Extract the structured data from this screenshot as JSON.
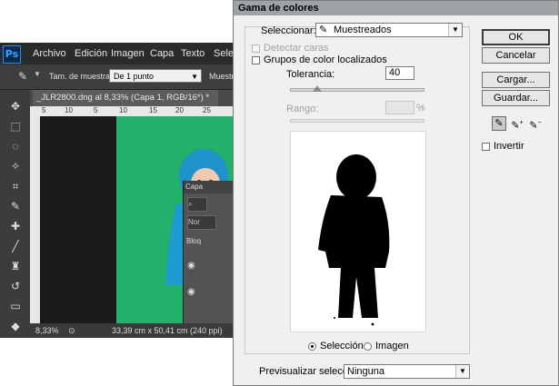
{
  "photoshop": {
    "logo": "Ps",
    "menus": [
      "Archivo",
      "Edición",
      "Imagen",
      "Capa",
      "Texto",
      "Selecc"
    ],
    "options": {
      "sample_size_label": "Tam. de muestra:",
      "sample_size_value": "De 1 punto",
      "sample_label": "Muestra:"
    },
    "document_tab": "_JLR2800.dng al 8,33% (Capa 1, RGB/16*) *",
    "ruler_ticks": [
      "5",
      "10",
      "5",
      "10",
      "15",
      "20",
      "25"
    ],
    "status": {
      "zoom": "8,33%",
      "doc_info": "33,39 cm x 50,41 cm (240 ppi)"
    },
    "layers_panel": {
      "title": "Capa",
      "kind_text": "Nor",
      "lock_text": "Bloq"
    }
  },
  "dialog": {
    "title": "Gama de colores",
    "select_label": "Seleccionar:",
    "select_value": "Muestreados",
    "detect_faces_label": "Detectar caras",
    "detect_faces_checked": false,
    "localized_label": "Grupos de color localizados",
    "localized_checked": false,
    "tolerance_label": "Tolerancia:",
    "tolerance_value": "40",
    "tolerance_fraction": 0.2,
    "range_label": "Rango:",
    "range_value": "",
    "range_unit": "%",
    "view_selection_label": "Selección",
    "view_image_label": "Imagen",
    "view_selected": "selection",
    "preview_label": "Previsualizar selección:",
    "preview_value": "Ninguna",
    "buttons": {
      "ok": "OK",
      "cancel": "Cancelar",
      "load": "Cargar...",
      "save": "Guardar..."
    },
    "invert_label": "Invertir",
    "invert_checked": false
  }
}
